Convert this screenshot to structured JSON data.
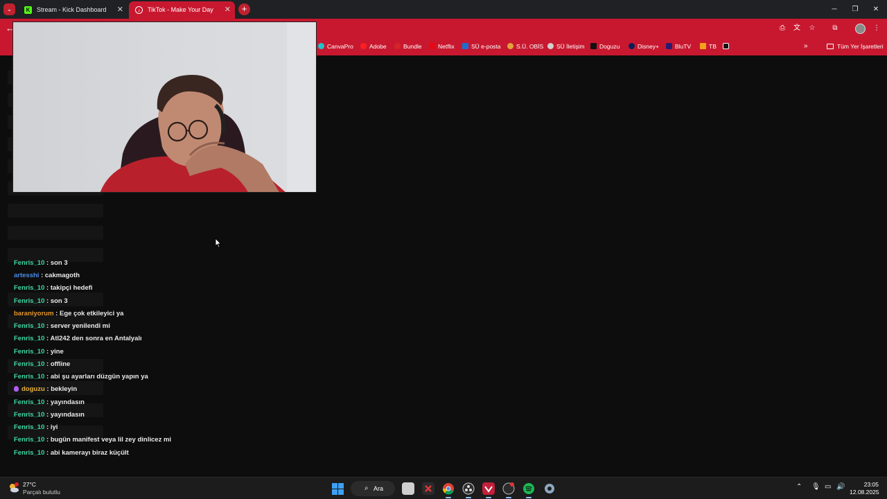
{
  "browser": {
    "tabs": [
      {
        "label": "Stream - Kick Dashboard",
        "favicon": "K"
      },
      {
        "label": "TikTok - Make Your Day"
      }
    ],
    "bookmarks": [
      {
        "label": "CanvaPro",
        "color": "#20c4cb"
      },
      {
        "label": "Adobe",
        "color": "#ff1f1f"
      },
      {
        "label": "Bundle",
        "color": "#d8232a"
      },
      {
        "label": "Netflix",
        "color": "#e50914"
      },
      {
        "label": "SÜ e-posta",
        "color": "#1b6fd1"
      },
      {
        "label": "S.Ü. OBİS",
        "color": "#e0a33c"
      },
      {
        "label": "SÜ İletişim",
        "color": "#cfcfcf"
      },
      {
        "label": "Doguzu",
        "color": "#111111"
      },
      {
        "label": "Disney+",
        "color": "#0b1e5b"
      },
      {
        "label": "BluTV",
        "color": "#2a1a6e"
      },
      {
        "label": "TB",
        "color": "#f3a01c"
      }
    ],
    "bookmarks_folder": "Tüm Yer İşaretleri",
    "bookmarks_more": "»"
  },
  "chat": [
    {
      "user": "Fenris_10",
      "color": "#3fd7a4",
      "message": "son 3"
    },
    {
      "user": "artesshi",
      "color": "#4a8ce6",
      "message": "cakmagoth"
    },
    {
      "user": "Fenris_10",
      "color": "#3fd7a4",
      "message": "takipçi hedefi"
    },
    {
      "user": "Fenris_10",
      "color": "#3fd7a4",
      "message": "son 3"
    },
    {
      "user": "baraniyorum",
      "color": "#e89a2c",
      "message": "Ege çok etkileyici ya"
    },
    {
      "user": "Fenris_10",
      "color": "#3fd7a4",
      "message": "server yenilendi mi"
    },
    {
      "user": "Fenris_10",
      "color": "#3fd7a4",
      "message": "Atl242 den sonra en Antalyalı"
    },
    {
      "user": "Fenris_10",
      "color": "#3fd7a4",
      "message": "yine"
    },
    {
      "user": "Fenris_10",
      "color": "#3fd7a4",
      "message": "offline"
    },
    {
      "user": "Fenris_10",
      "color": "#3fd7a4",
      "message": "abi şu ayarları düzgün yapın ya"
    },
    {
      "user": "doguzu",
      "color": "#e8b23a",
      "message": "bekleyin",
      "badge": true
    },
    {
      "user": "Fenris_10",
      "color": "#3fd7a4",
      "message": "yayındasın"
    },
    {
      "user": "Fenris_10",
      "color": "#3fd7a4",
      "message": "yayındasın"
    },
    {
      "user": "Fenris_10",
      "color": "#3fd7a4",
      "message": "iyi"
    },
    {
      "user": "Fenris_10",
      "color": "#3fd7a4",
      "message": "bugün manifest veya lil zey dinlicez mi"
    },
    {
      "user": "Fenris_10",
      "color": "#3fd7a4",
      "message": "abi kamerayı biraz küçült"
    }
  ],
  "chat_separator": " : ",
  "taskbar": {
    "weather": {
      "temp": "27°C",
      "desc": "Parçalı bulutlu"
    },
    "search_label": "Ara",
    "time": "23:05",
    "date": "12.08.2025"
  },
  "colors": {
    "browser_accent": "#c8182f",
    "kick_green": "#53fc18",
    "background": "#0d0d0d"
  }
}
